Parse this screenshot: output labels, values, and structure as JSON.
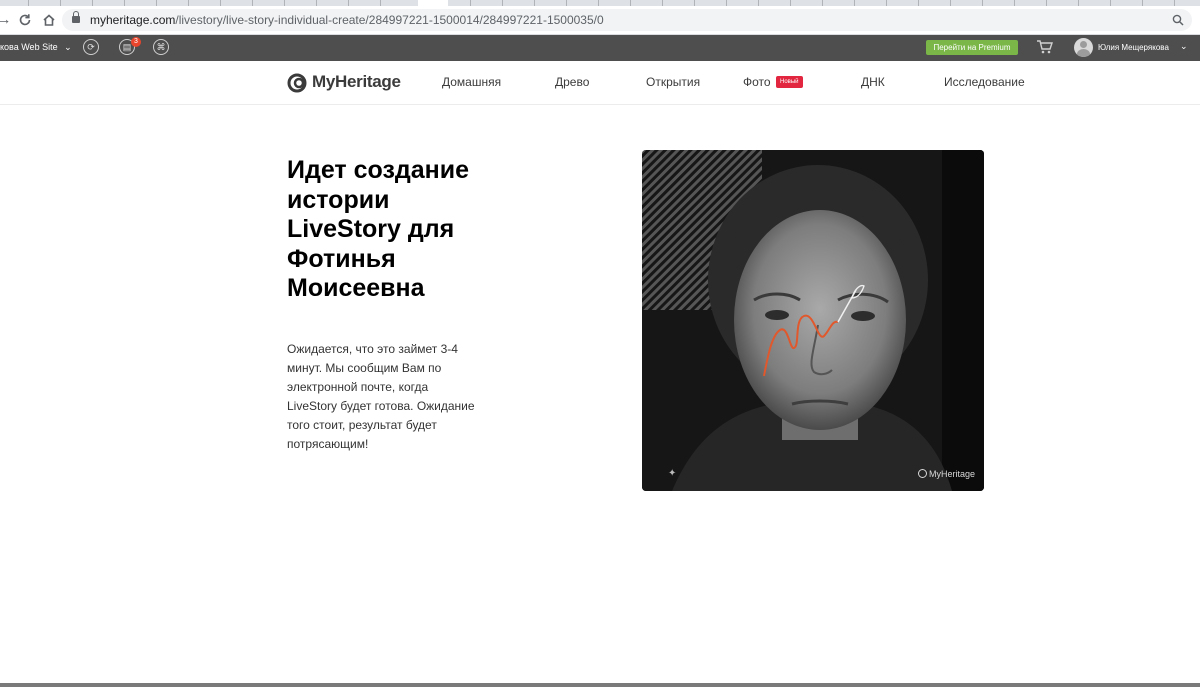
{
  "browser": {
    "url_host": "myheritage.com",
    "url_path": "/livestory/live-story-individual-create/284997221-1500014/284997221-1500035/0",
    "icons": {
      "forward": "forward-arrow-icon",
      "reload": "reload-icon",
      "home": "home-icon",
      "lock": "lock-icon",
      "zoom": "zoom-icon"
    }
  },
  "toolbar": {
    "site_selector": "кова Web Site",
    "notifications_count": "3",
    "premium_label": "Перейти на Premium",
    "user_name": "Юлия Мещерякова",
    "colors": {
      "background": "#4e4e4e",
      "premium": "#7ab648",
      "badge": "#e8452c"
    }
  },
  "nav": {
    "logo_text": "MyHeritage",
    "items": [
      "Домашняя",
      "Древо",
      "Открытия",
      "Фото",
      "ДНК",
      "Исследование"
    ],
    "new_badge": "Новый",
    "colors": {
      "new_badge": "#e2263f"
    }
  },
  "content": {
    "title": "Идет создание истории LiveStory для Фотинья Моисеевна",
    "description": "Ожидается, что это займет 3-4 минут. Мы сообщим Вам по электронной почте, когда LiveStory будет готова. Ожидание того стоит, результат будет потрясающим!",
    "watermark": "MyHeritage",
    "colors": {
      "animation_stroke": "#e0582c"
    }
  }
}
